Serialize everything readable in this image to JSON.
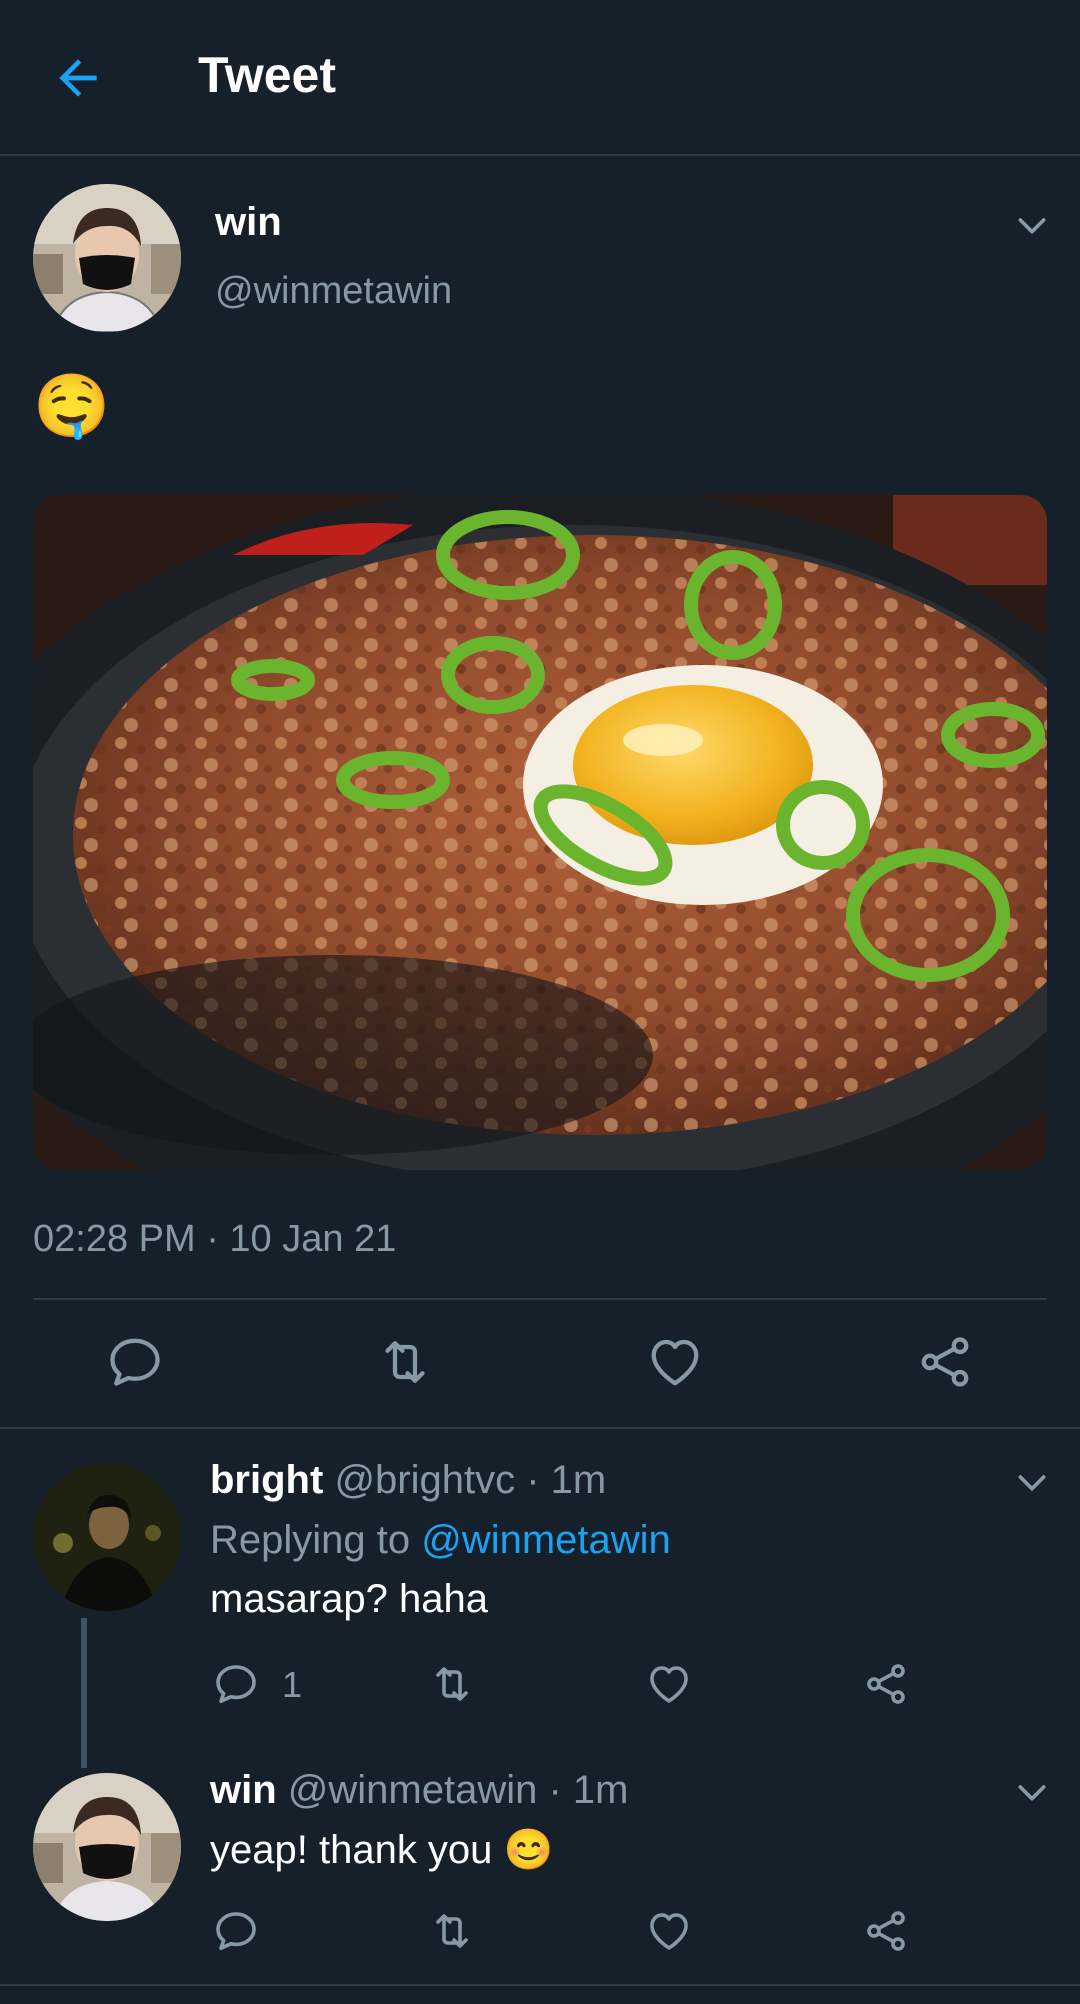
{
  "header": {
    "title": "Tweet"
  },
  "tweet": {
    "author_name": "win",
    "author_handle": "@winmetawin",
    "text": "🤤",
    "timestamp": "02:28 PM · 10 Jan 21",
    "media_alt": "Sisig with egg and green chili on a sizzling plate"
  },
  "replies": [
    {
      "author_name": "bright",
      "meta": "@brightvc · 1m",
      "replying_prefix": "Replying to ",
      "replying_handle": "@winmetawin",
      "text": "masarap? haha",
      "reply_count": "1"
    },
    {
      "author_name": "win",
      "meta": "@winmetawin · 1m",
      "text": "yeap! thank you 😊"
    }
  ],
  "colors": {
    "background": "#15202b",
    "accent": "#1da1f2",
    "muted": "#8899a6",
    "divider": "#2f3b47"
  },
  "icons": [
    "back-arrow-icon",
    "chevron-down-icon",
    "reply-icon",
    "retweet-icon",
    "like-icon",
    "share-icon"
  ]
}
